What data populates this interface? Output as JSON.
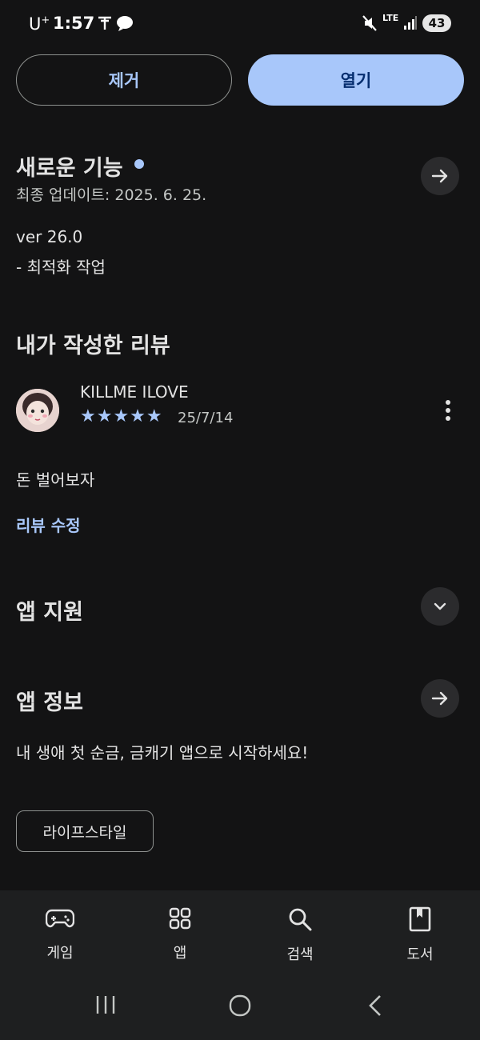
{
  "status_bar": {
    "carrier": "U",
    "carrier_sup": "+",
    "time": "1:57",
    "network": "LTE",
    "battery": "43"
  },
  "actions": {
    "remove_label": "제거",
    "open_label": "열기"
  },
  "whats_new": {
    "title": "새로운 기능",
    "last_updated": "최종 업데이트: 2025. 6. 25.",
    "version": "ver 26.0",
    "notes": "- 최적화 작업"
  },
  "my_review": {
    "title": "내가 작성한 리뷰",
    "author": "KILLME ILOVE",
    "stars": "★★★★★",
    "date": "25/7/14",
    "text": "돈 벌어보자",
    "edit_label": "리뷰 수정"
  },
  "app_support": {
    "title": "앱 지원"
  },
  "app_info": {
    "title": "앱 정보",
    "description": "내 생애 첫 순금, 금캐기 앱으로 시작하세요!",
    "category_chip": "라이프스타일"
  },
  "bottom_nav": {
    "items": [
      {
        "label": "게임",
        "icon": "gamepad-icon"
      },
      {
        "label": "앱",
        "icon": "apps-grid-icon"
      },
      {
        "label": "검색",
        "icon": "search-icon"
      },
      {
        "label": "도서",
        "icon": "book-icon"
      }
    ]
  },
  "colors": {
    "background": "#131314",
    "accent": "#a8c7fa",
    "accent_text": "#062e6f"
  }
}
